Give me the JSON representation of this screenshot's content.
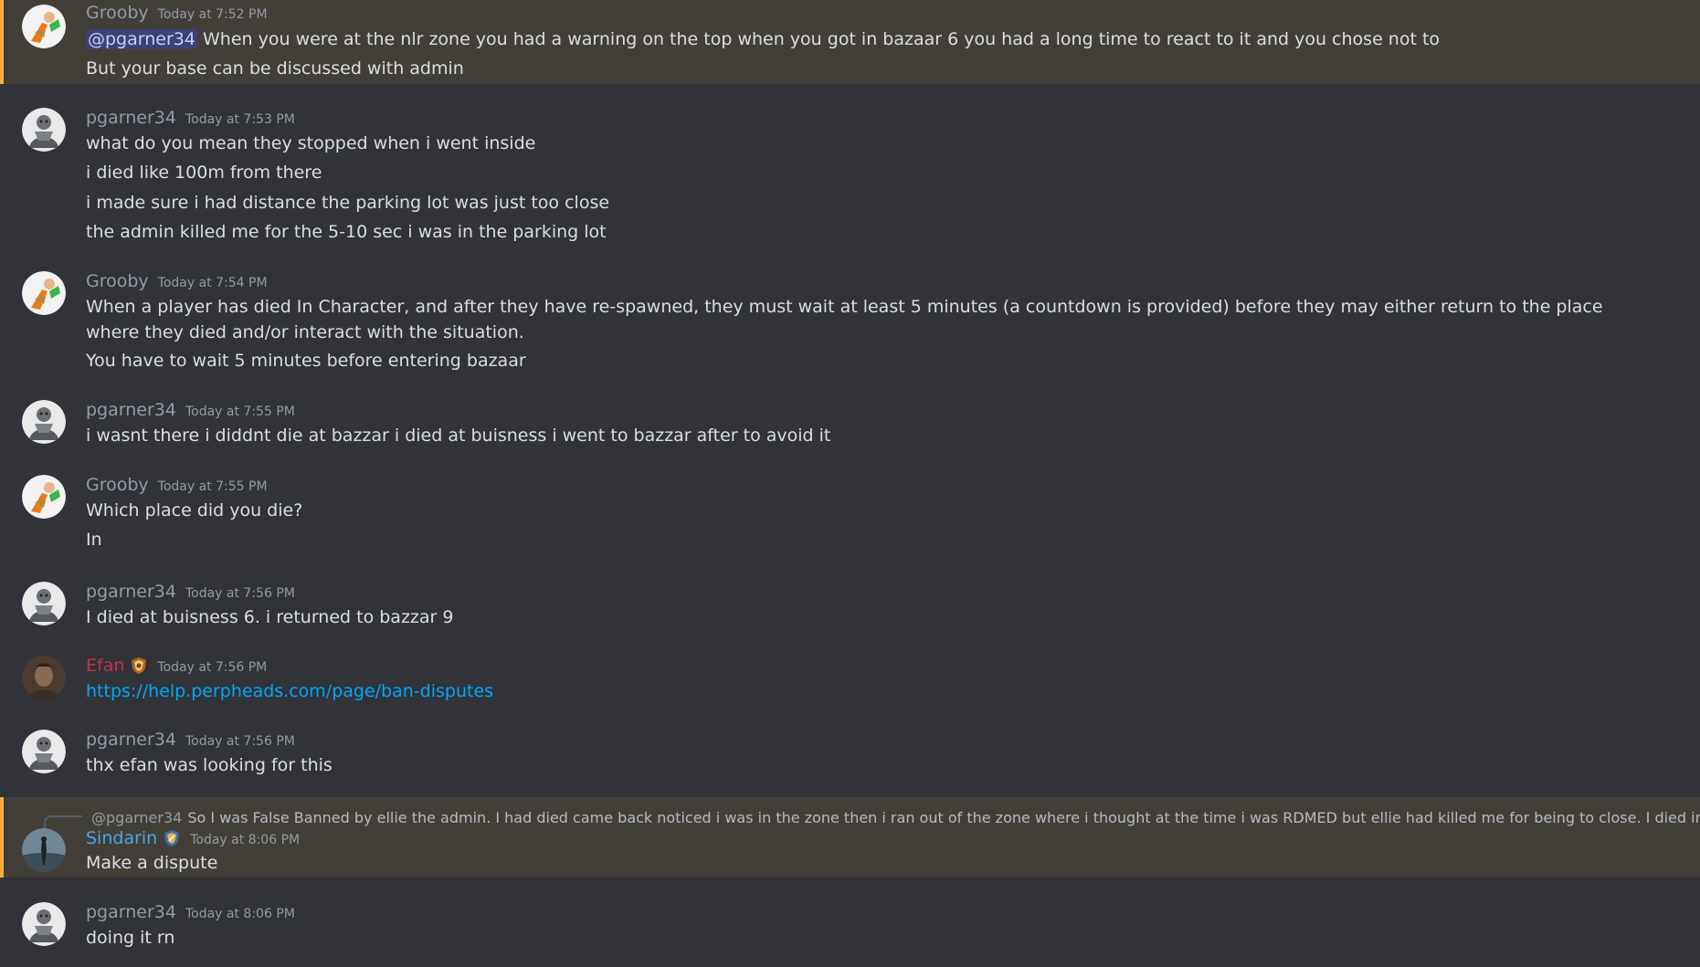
{
  "messages": [
    {
      "author": "Grooby",
      "time": "Today at 7:52 PM",
      "highlighted": true,
      "mention": "@pgarner34",
      "lines": [
        "When you were at the nlr zone you had a warning on the top when you got in bazaar 6 you had a long time to react to it and you chose not to",
        "But your base can be discussed with admin"
      ]
    },
    {
      "author": "pgarner34",
      "time": "Today at 7:53 PM",
      "lines": [
        "what do you mean they stopped when i went inside",
        "i died like 100m from there",
        "i made sure i had distance the parking lot was just too close",
        "the admin killed me for the 5-10 sec i was in the parking lot"
      ]
    },
    {
      "author": "Grooby",
      "time": "Today at 7:54 PM",
      "lines": [
        "When a player has died In Character, and after they have re-spawned, they must wait at least 5 minutes (a countdown is provided) before they may either return to the place where they died and/or interact with the situation.",
        "You have to wait 5 minutes before entering bazaar"
      ]
    },
    {
      "author": "pgarner34",
      "time": "Today at 7:55 PM",
      "lines": [
        "i wasnt there i diddnt die at bazzar  i died at buisness i went to bazzar after to avoid it"
      ]
    },
    {
      "author": "Grooby",
      "time": "Today at 7:55 PM",
      "lines": [
        "Which place did you die?",
        "In"
      ]
    },
    {
      "author": "pgarner34",
      "time": "Today at 7:56 PM",
      "lines": [
        "I died at buisness 6. i returned to bazzar 9"
      ]
    },
    {
      "author": "Efan",
      "time": "Today at 7:56 PM",
      "link": "https://help.perpheads.com/page/ban-disputes"
    },
    {
      "author": "pgarner34",
      "time": "Today at 7:56 PM",
      "lines": [
        "thx efan was looking for this"
      ]
    },
    {
      "author": "Sindarin",
      "time": "Today at 8:06 PM",
      "highlighted": true,
      "reply": {
        "author": "@pgarner34",
        "text": "So I was False Banned by ellie the admin. I had died came back noticed i was in the zone then i ran out of the zone where i thought at the time i was RDMED but ellie had killed me for being to close. I died in buis"
      },
      "lines": [
        "Make a dispute"
      ]
    },
    {
      "author": "pgarner34",
      "time": "Today at 8:06 PM",
      "lines": [
        "doing it rn"
      ]
    }
  ],
  "icons": {
    "role_badge": "shield-badge-icon",
    "reply_attachment": "image-icon"
  },
  "colors": {
    "background": "#313338",
    "highlight_bg": "#423f38",
    "highlight_bar": "#f0b232",
    "mention_bg": "#3d4174",
    "link": "#00a8fc",
    "efan_name": "#c0344e",
    "sindarin_name": "#4da3e8"
  }
}
